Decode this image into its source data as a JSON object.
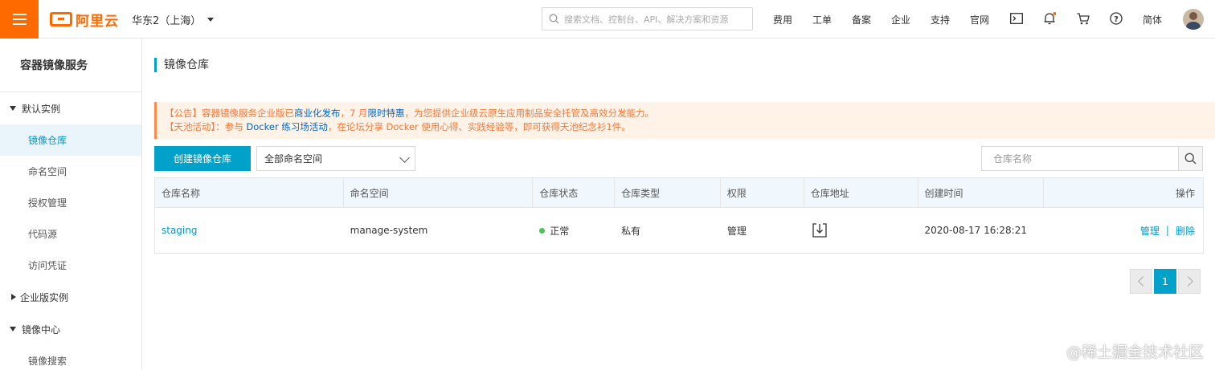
{
  "topbar": {
    "logo_text": "阿里云",
    "region": "华东2（上海）",
    "search_placeholder": "搜索文档、控制台、API、解决方案和资源",
    "links": [
      "费用",
      "工单",
      "备案",
      "企业",
      "支持",
      "官网"
    ],
    "language": "简体",
    "brand_color": "#ff6a00"
  },
  "sidebar": {
    "title": "容器镜像服务",
    "group_default": "默认实例",
    "items": [
      "镜像仓库",
      "命名空间",
      "授权管理",
      "代码源",
      "访问凭证"
    ],
    "active_item": "镜像仓库",
    "group_enterprise": "企业版实例",
    "group_image_center": "镜像中心",
    "image_center_items": [
      "镜像搜索"
    ]
  },
  "main": {
    "page_title": "镜像仓库",
    "notice": {
      "line1_a": "【公告】容器镜像服务企业版已",
      "line1_link1": "商业化发布",
      "line1_b": "，7 月",
      "line1_link2": "限时特惠",
      "line1_c": "，为您提供企业级云原生应用制品安全托管及高效分发能力。",
      "line2_a": "【天池活动】：参与 ",
      "line2_link": "Docker 练习场活动",
      "line2_b": "，在论坛分享 Docker 使用心得、实践经验等，即可获得天池纪念衫1件。"
    },
    "create_button": "创建镜像仓库",
    "namespace_select": "全部命名空间",
    "repo_search_placeholder": "仓库名称",
    "accent_color": "#00a2ca",
    "table": {
      "headers": [
        "仓库名称",
        "命名空间",
        "仓库状态",
        "仓库类型",
        "权限",
        "仓库地址",
        "创建时间",
        "操作"
      ],
      "rows": [
        {
          "name": "staging",
          "namespace": "manage-system",
          "status": "正常",
          "type": "私有",
          "permission": "管理",
          "address_icon": "download-icon",
          "created": "2020-08-17 16:28:21",
          "action_manage": "管理",
          "action_sep": "|",
          "action_delete": "删除"
        }
      ]
    },
    "pagination": {
      "current_page": "1"
    }
  },
  "watermark": "@稀土掘金技术社区"
}
